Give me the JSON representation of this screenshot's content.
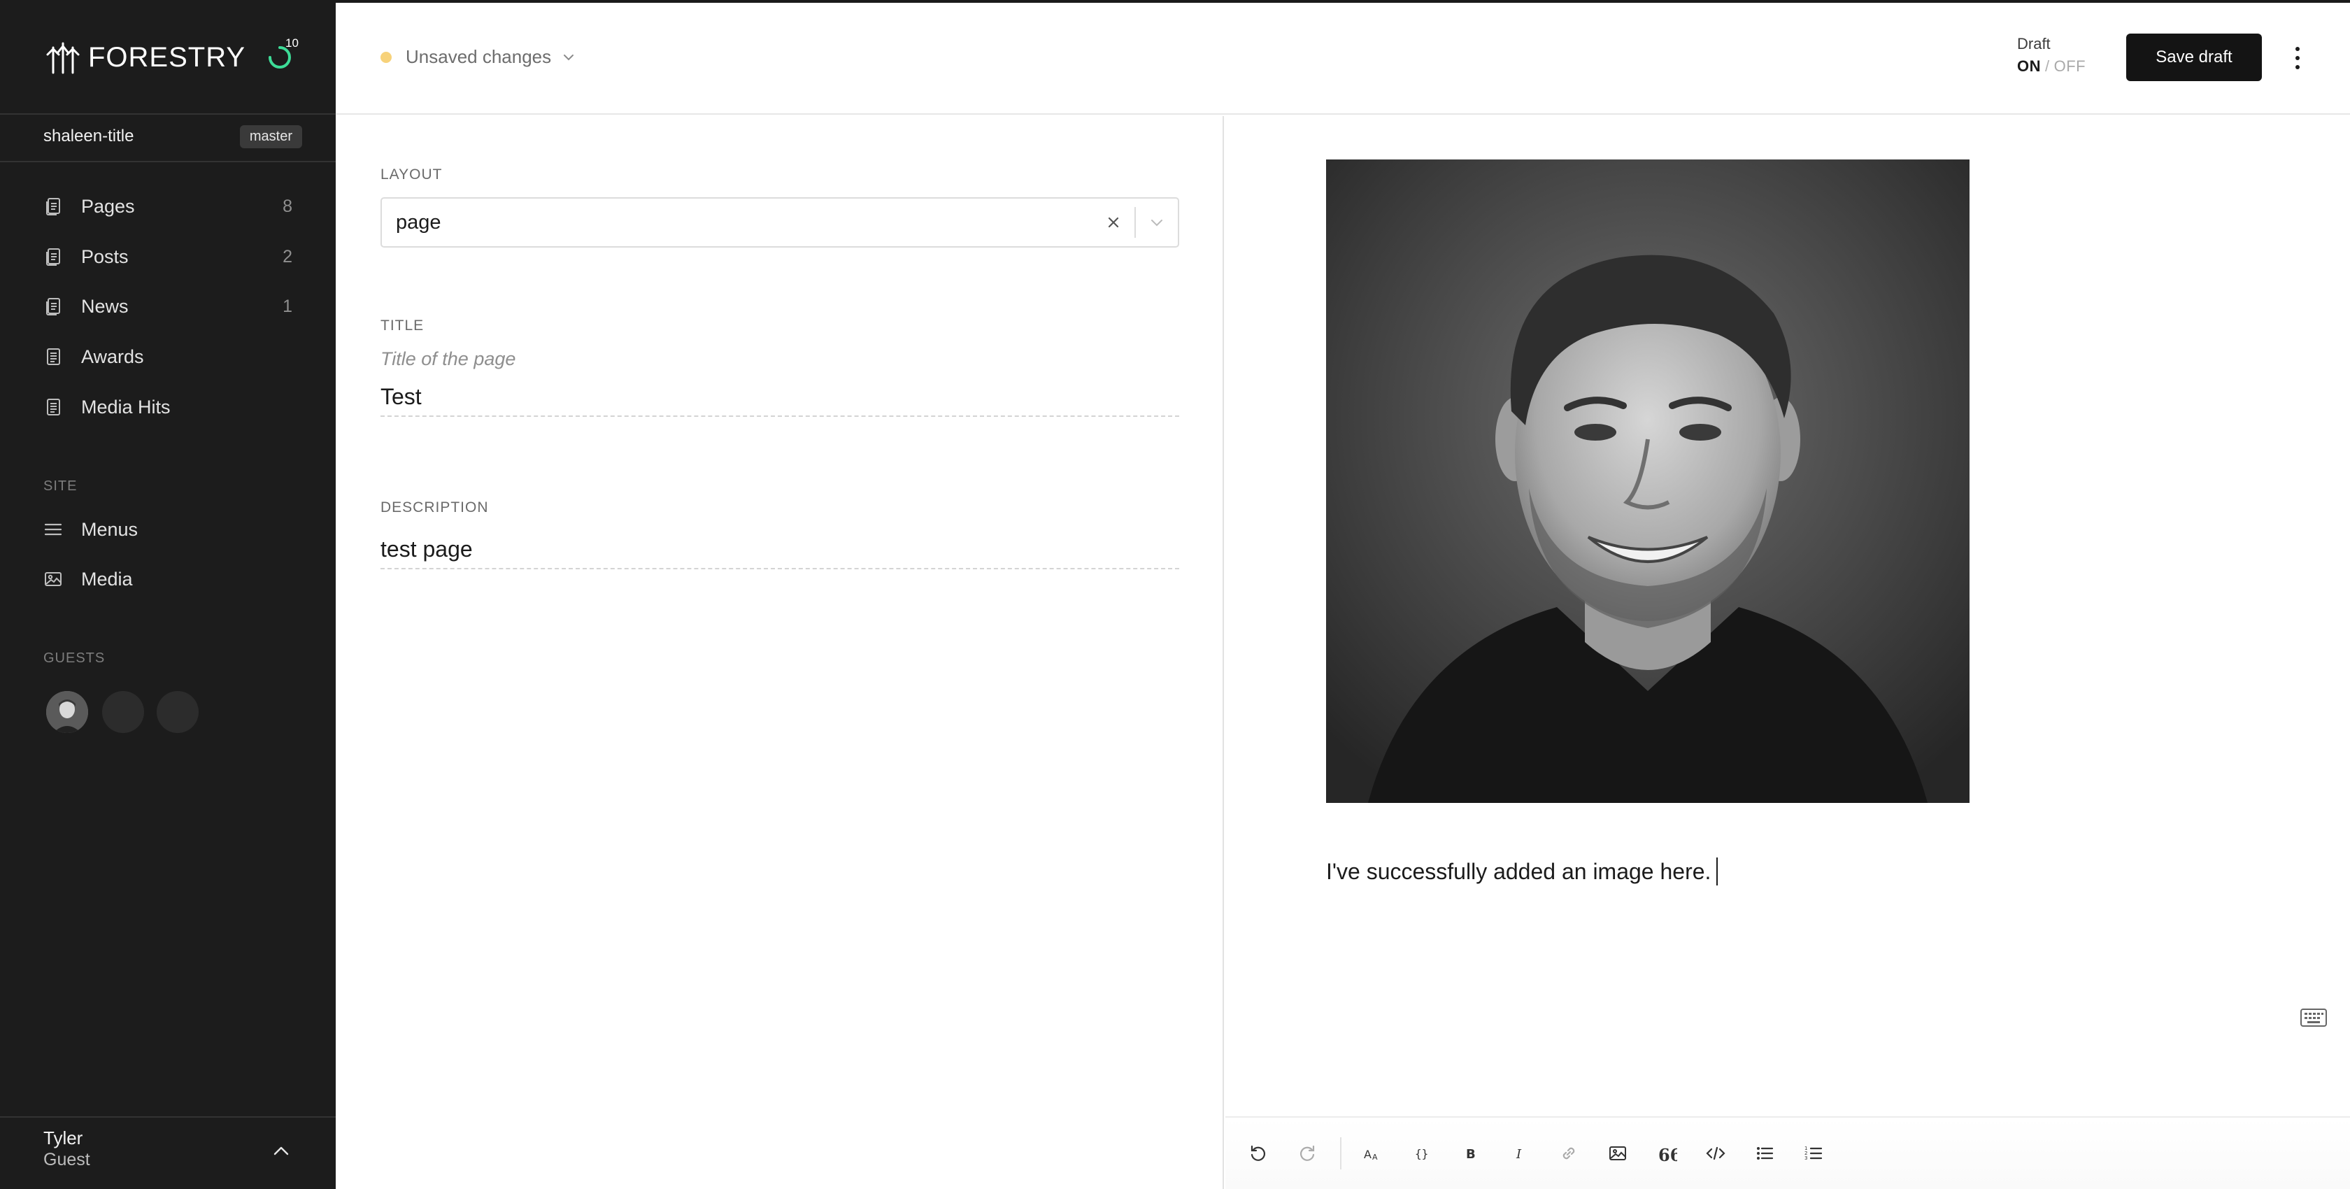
{
  "brand": {
    "name": "FORESTRY",
    "sync_count": "10"
  },
  "sidebar": {
    "branch": {
      "name": "shaleen-title",
      "badge": "master"
    },
    "collections": [
      {
        "label": "Pages",
        "count": "8",
        "icon": "document-icon"
      },
      {
        "label": "Posts",
        "count": "2",
        "icon": "document-icon"
      },
      {
        "label": "News",
        "count": "1",
        "icon": "document-icon"
      },
      {
        "label": "Awards",
        "count": "",
        "icon": "document-icon"
      },
      {
        "label": "Media Hits",
        "count": "",
        "icon": "document-icon"
      }
    ],
    "site_section": "SITE",
    "site_items": [
      {
        "label": "Menus",
        "icon": "menu-icon"
      },
      {
        "label": "Media",
        "icon": "image-icon"
      }
    ],
    "guests_section": "GUESTS",
    "user": {
      "name": "Tyler",
      "role": "Guest"
    }
  },
  "header": {
    "status": "Unsaved changes",
    "draft": {
      "label": "Draft",
      "on": "ON",
      "sep": "/",
      "off": "OFF"
    },
    "save_label": "Save draft"
  },
  "form": {
    "layout": {
      "label": "LAYOUT",
      "value": "page"
    },
    "title": {
      "label": "TITLE",
      "helper": "Title of the page",
      "value": "Test"
    },
    "description": {
      "label": "DESCRIPTION",
      "value": "test page"
    }
  },
  "editor": {
    "body_text": "I've successfully added an image here.",
    "toolbar": [
      "undo-icon",
      "redo-icon",
      "text-size-icon",
      "code-braces-icon",
      "bold-icon",
      "italic-icon",
      "link-icon",
      "image-icon",
      "quote-icon",
      "code-icon",
      "bullet-list-icon",
      "numbered-list-icon"
    ]
  },
  "colors": {
    "sidebar_bg": "#1c1c1c",
    "unsaved_dot": "#f7d27a",
    "sync_ring": "#3ddc97",
    "save_button_bg": "#141414"
  }
}
